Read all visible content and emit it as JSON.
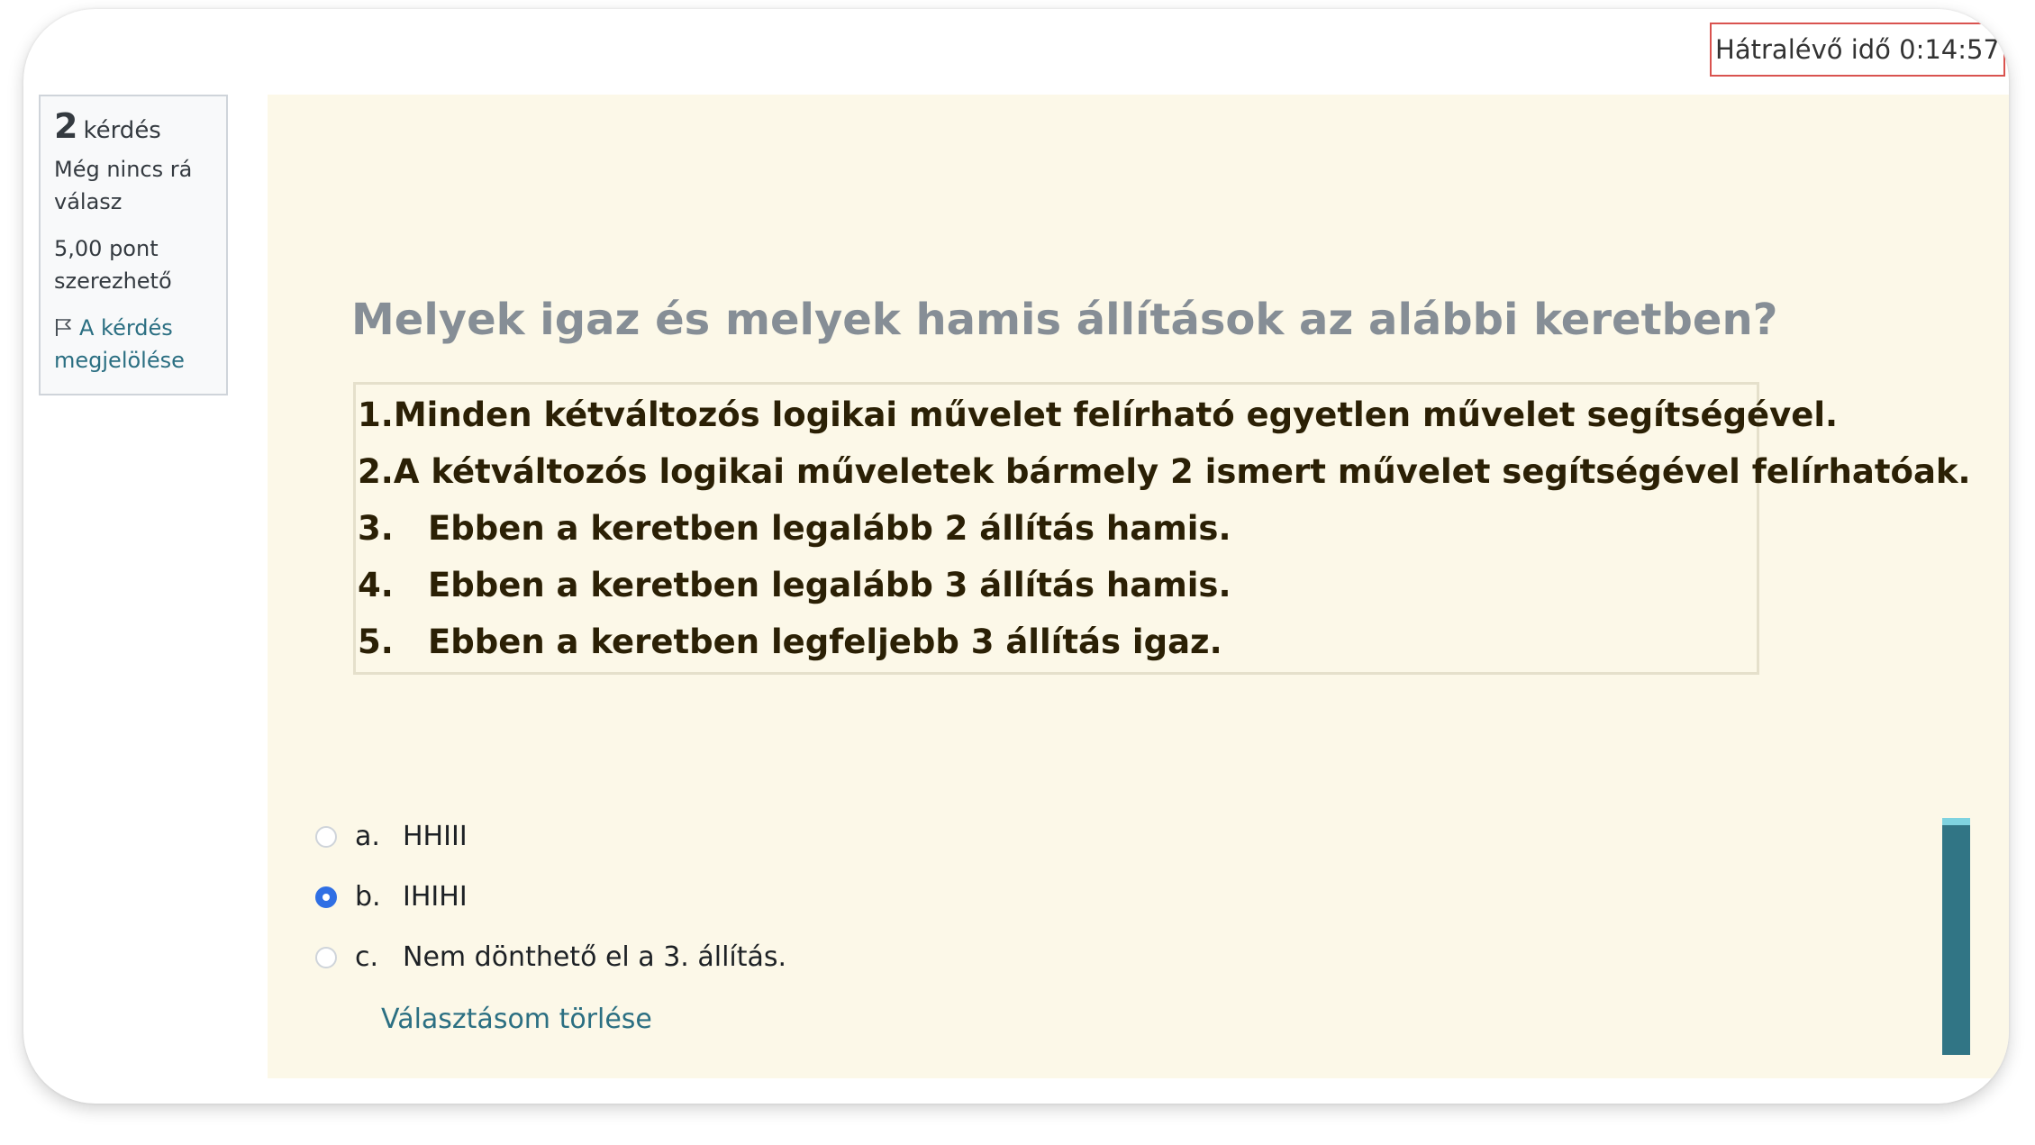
{
  "timer": {
    "label": "Hátralévő idő",
    "value": "0:14:57",
    "display": "Hátralévő idő 0:14:57"
  },
  "info": {
    "number": "2",
    "number_label": "kérdés",
    "state": "Még nincs rá válasz",
    "grade": "5,00 pont szerezhető",
    "flag_label": "A kérdés megjelölése"
  },
  "question": {
    "text": "Melyek igaz és melyek hamis állítások az alábbi keretben?",
    "statements": [
      {
        "num": "1.",
        "text": "Minden kétváltozós logikai művelet felírható egyetlen művelet segítségével."
      },
      {
        "num": "2.",
        "text": "A kétváltozós logikai műveletek bármely 2 ismert művelet segítségével felírhatóak."
      },
      {
        "num": "3.",
        "text": "Ebben a keretben legalább 2 állítás hamis."
      },
      {
        "num": "4.",
        "text": "Ebben a keretben legalább 3 állítás hamis."
      },
      {
        "num": "5.",
        "text": "Ebben a keretben legfeljebb 3 állítás igaz."
      }
    ]
  },
  "answers": [
    {
      "letter": "a.",
      "text": "HHIII",
      "selected": false
    },
    {
      "letter": "b.",
      "text": "IHIHI",
      "selected": true
    },
    {
      "letter": "c.",
      "text": "Nem dönthető el a 3. állítás.",
      "selected": false
    }
  ],
  "clear_choice": "Választásom törlése",
  "colors": {
    "content_bg": "#fcf8e8",
    "link": "#2b6f82",
    "timer_border": "#d9534f",
    "radio_selected": "#2f6fe4",
    "scrollbar": "#317585"
  }
}
